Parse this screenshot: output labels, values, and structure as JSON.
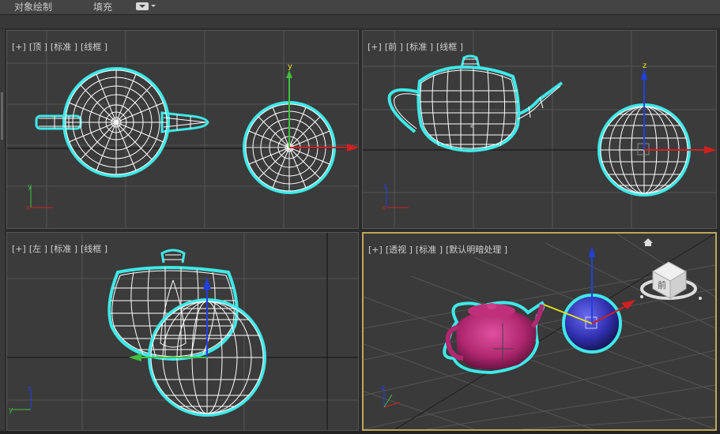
{
  "menu": {
    "items": [
      "对象绘制",
      "填充"
    ]
  },
  "viewports": {
    "top": {
      "labels": [
        "[+]",
        "[顶 ]",
        "[标准 ]",
        "[线框 ]"
      ]
    },
    "front": {
      "labels": [
        "[+]",
        "[前 ]",
        "[标准 ]",
        "[线框 ]"
      ]
    },
    "left": {
      "labels": [
        "[+]",
        "[左 ]",
        "[标准 ]",
        "[线框 ]"
      ]
    },
    "persp": {
      "labels": [
        "[+]",
        "[透视 ]",
        "[标准 ]",
        "[默认明暗处理 ]"
      ]
    }
  },
  "axes": {
    "x": "x",
    "y": "y",
    "z": "z"
  },
  "viewcube": {
    "face_label": "前"
  },
  "colors": {
    "wire": "#ffffff",
    "selection": "#3fe8e8",
    "active_border": "#bfa75a",
    "axis_x": "#d02020",
    "axis_y": "#40c040",
    "axis_z": "#2040e0",
    "teapot_shaded": "#c0307a",
    "sphere_shaded": "#3a3ab8"
  }
}
